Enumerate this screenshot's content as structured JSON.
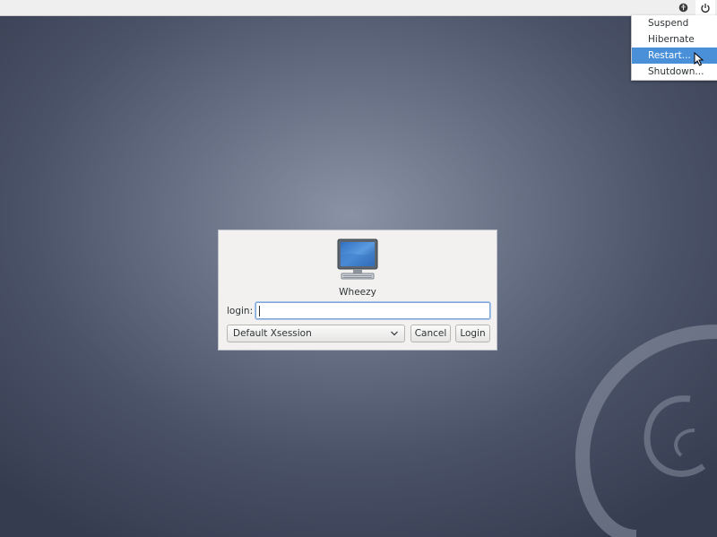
{
  "topbar": {
    "icons": [
      "accessibility-icon",
      "power-icon"
    ]
  },
  "power_menu": {
    "items": [
      {
        "label": "Suspend",
        "selected": false
      },
      {
        "label": "Hibernate",
        "selected": false
      },
      {
        "label": "Restart...",
        "selected": true
      },
      {
        "label": "Shutdown...",
        "selected": false
      }
    ]
  },
  "login_box": {
    "hostname": "Wheezy",
    "login_label": "login:",
    "login_value": "",
    "session_selected": "Default Xsession",
    "cancel_label": "Cancel",
    "login_button_label": "Login"
  },
  "colors": {
    "menu_highlight": "#4a90d9",
    "background_center": "#8a93a6",
    "background_edge": "#363c50"
  }
}
